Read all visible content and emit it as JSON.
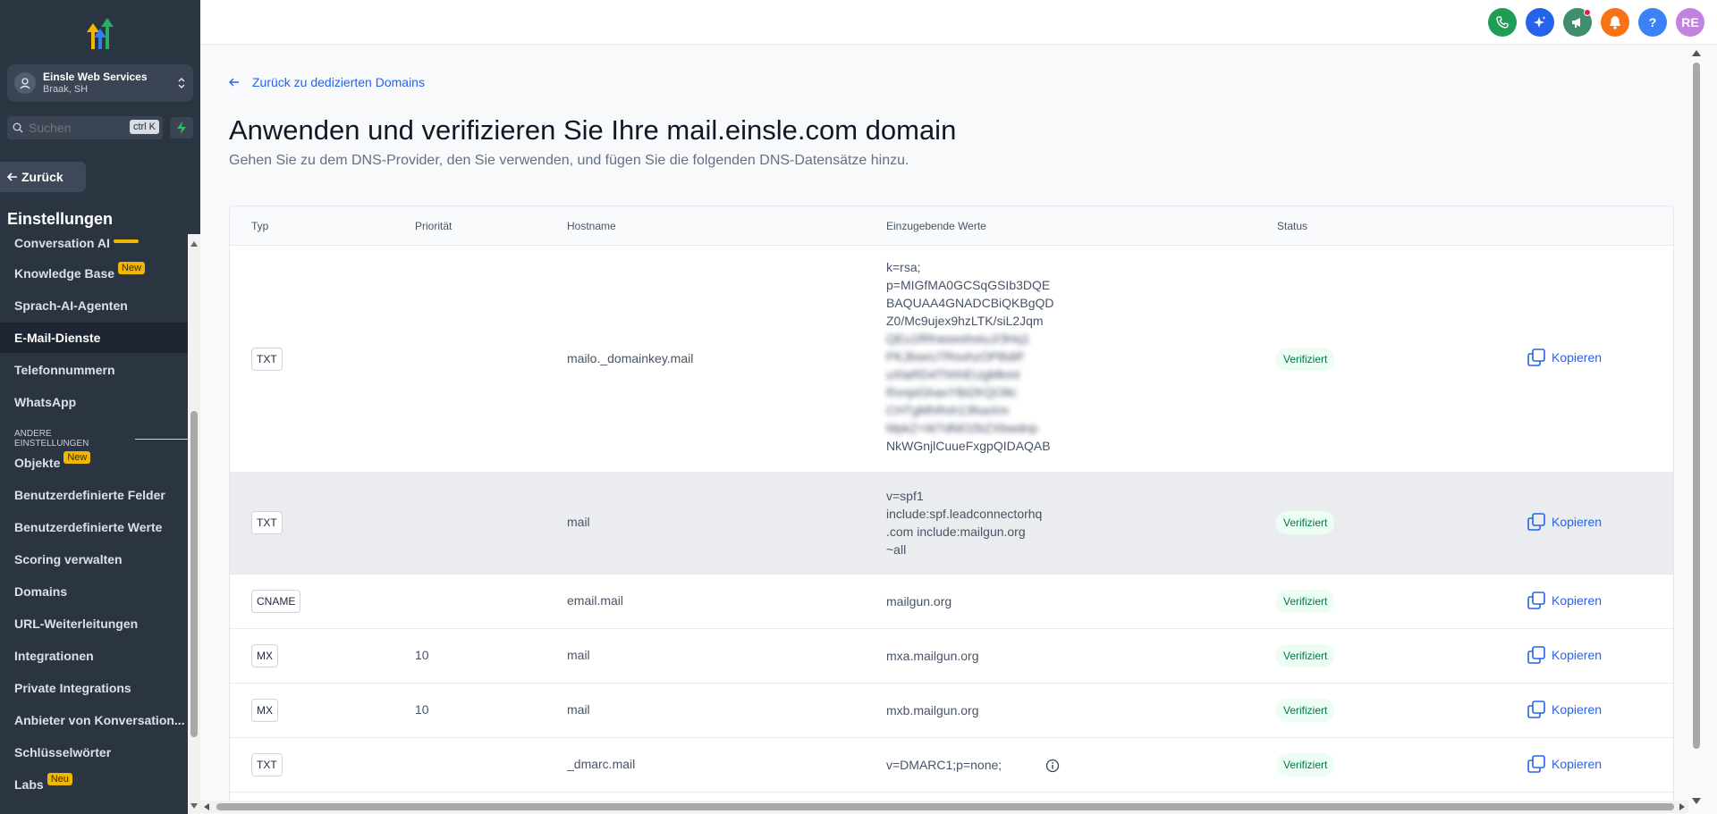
{
  "account": {
    "name": "Einsle Web Services",
    "location": "Braak, SH"
  },
  "search": {
    "placeholder": "Suchen",
    "shortcut": "ctrl K"
  },
  "back_button": "Zurück",
  "settings_title": "Einstellungen",
  "sidebar": {
    "items": [
      {
        "label": "Conversation AI",
        "badge": ""
      },
      {
        "label": "Knowledge Base",
        "badge": "New"
      },
      {
        "label": "Sprach-AI-Agenten",
        "badge": ""
      },
      {
        "label": "E-Mail-Dienste",
        "badge": "",
        "active": true
      },
      {
        "label": "Telefonnummern",
        "badge": ""
      },
      {
        "label": "WhatsApp",
        "badge": ""
      }
    ],
    "section_label": "ANDERE EINSTELLUNGEN",
    "other_items": [
      {
        "label": "Objekte",
        "badge": "New"
      },
      {
        "label": "Benutzerdefinierte Felder",
        "badge": ""
      },
      {
        "label": "Benutzerdefinierte Werte",
        "badge": ""
      },
      {
        "label": "Scoring verwalten",
        "badge": ""
      },
      {
        "label": "Domains",
        "badge": ""
      },
      {
        "label": "URL-Weiterleitungen",
        "badge": ""
      },
      {
        "label": "Integrationen",
        "badge": ""
      },
      {
        "label": "Private Integrations",
        "badge": ""
      },
      {
        "label": "Anbieter von Konversation...",
        "badge": ""
      },
      {
        "label": "Schlüsselwörter",
        "badge": ""
      },
      {
        "label": "Labs",
        "badge": "Neu"
      }
    ]
  },
  "header": {
    "avatar_initials": "RE",
    "icons": [
      "phone-icon",
      "sparkle-icon",
      "megaphone-icon",
      "bell-icon",
      "help-icon"
    ],
    "colors": {
      "phone": "#1f9d55",
      "sparkle": "#2563eb",
      "megaphone": "#3f8f6e",
      "bell": "#f97316",
      "help": "#3b82f6",
      "avatar": "#c084e0"
    }
  },
  "main": {
    "back_link": "Zurück zu dedizierten Domains",
    "title": "Anwenden und verifizieren Sie Ihre mail.einsle.com domain",
    "subtitle": "Gehen Sie zu dem DNS-Provider, den Sie verwenden, und fügen Sie die folgenden DNS-Datensätze hinzu.",
    "columns": [
      "Typ",
      "Priorität",
      "Hostname",
      "Einzugebende Werte",
      "Status"
    ],
    "copy_label": "Kopieren",
    "rows": [
      {
        "type": "TXT",
        "priority": "",
        "hostname": "mailo._domainkey.mail",
        "value_lines": [
          "k=rsa;",
          "p=MIGfMA0GCSqGSIb3DQE",
          "BAQUAA4GNADCBiQKBgQD",
          "Z0/Mc9ujex9hzLTK/siL2Jqm",
          "QEu1fRhaswshsIuJ/3Hq1",
          "PKJbseU7RsxhzOPBdIF",
          "uXlaRD4ThhhEUgMkmI",
          "RxnpiGhaxYlbl2KQO8c",
          "CHTgMhRsh13foaXm",
          "MpkZ+W7dfdO2bZXbwdnp",
          "NkWGnjlCuueFxgpQIDAQAB"
        ],
        "blurred_lines": [
          4,
          5,
          6,
          7,
          8,
          9
        ],
        "status": "Verifiziert"
      },
      {
        "type": "TXT",
        "priority": "",
        "hostname": "mail",
        "value_lines": [
          "v=spf1",
          "include:spf.leadconnectorhq",
          ".com include:mailgun.org",
          "~all"
        ],
        "status": "Verifiziert"
      },
      {
        "type": "CNAME",
        "priority": "",
        "hostname": "email.mail",
        "value_lines": [
          "mailgun.org"
        ],
        "status": "Verifiziert"
      },
      {
        "type": "MX",
        "priority": "10",
        "hostname": "mail",
        "value_lines": [
          "mxa.mailgun.org"
        ],
        "status": "Verifiziert"
      },
      {
        "type": "MX",
        "priority": "10",
        "hostname": "mail",
        "value_lines": [
          "mxb.mailgun.org"
        ],
        "status": "Verifiziert"
      },
      {
        "type": "TXT",
        "priority": "",
        "hostname": "_dmarc.mail",
        "value_lines": [
          "v=DMARC1;p=none;"
        ],
        "status": "Verifiziert",
        "has_info": true
      }
    ]
  }
}
